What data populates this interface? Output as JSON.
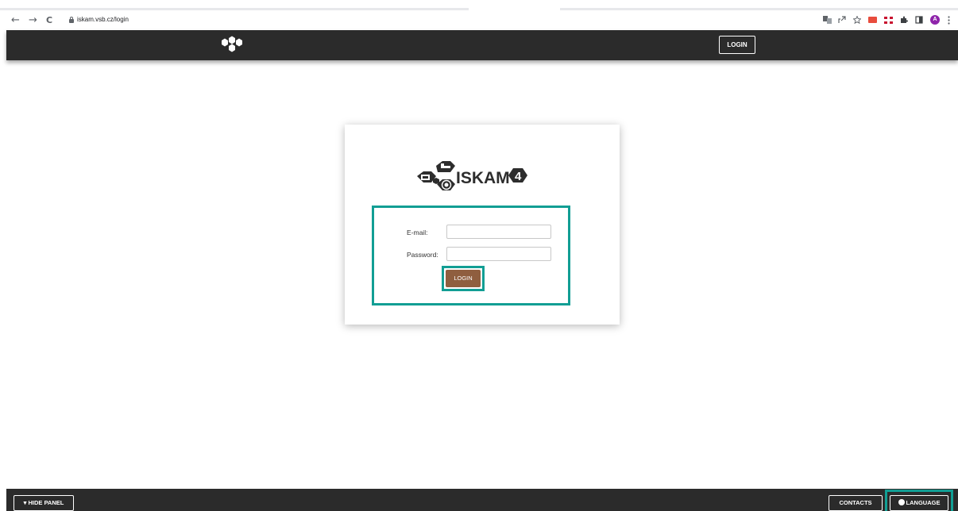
{
  "browser": {
    "url": "iskam.vsb.cz/login",
    "back_icon": "←",
    "forward_icon": "→",
    "reload_icon": "C",
    "avatar_letter": "A"
  },
  "topnav": {
    "login_label": "LOGIN"
  },
  "brand": {
    "name": "ISKAM",
    "version": "4"
  },
  "form": {
    "email_label": "E-mail:",
    "password_label": "Password:",
    "email_value": "",
    "password_value": "",
    "submit_label": "LOGIN"
  },
  "footer": {
    "hide_panel_label": "▾ HIDE PANEL",
    "contacts_label": "CONTACTS",
    "language_label": "LANGUAGE"
  },
  "colors": {
    "nav_bg": "#2b2b2b",
    "highlight": "#129e94",
    "login_button": "#8f5e3f"
  }
}
